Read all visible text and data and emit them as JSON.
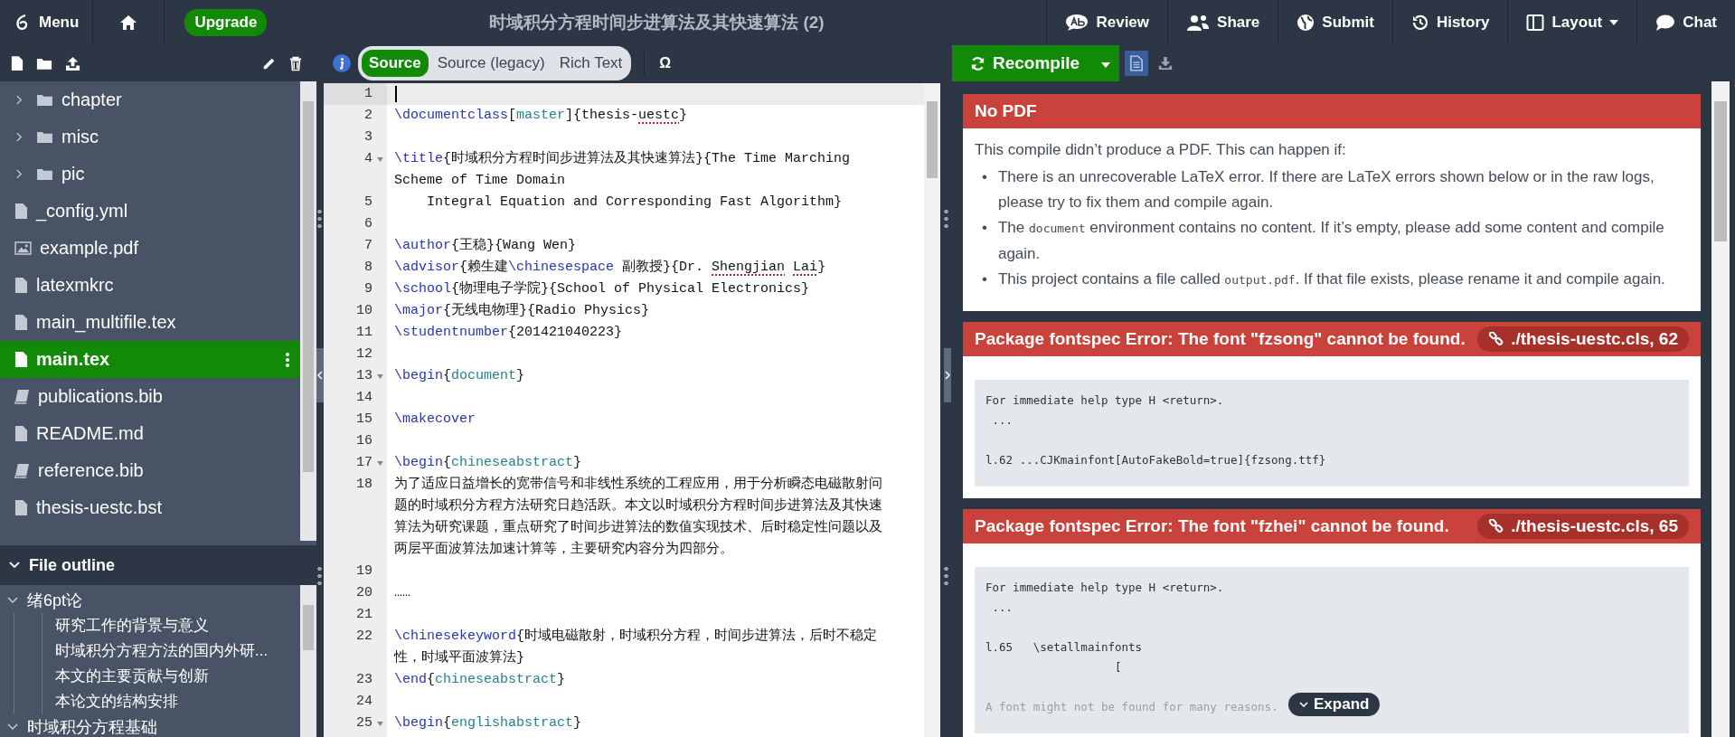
{
  "topbar": {
    "menu": "Menu",
    "upgrade": "Upgrade",
    "title": "时域积分方程时间步进算法及其快速算法 (2)",
    "actions": [
      {
        "kind": "review",
        "label": "Review"
      },
      {
        "kind": "share",
        "label": "Share"
      },
      {
        "kind": "submit",
        "label": "Submit"
      },
      {
        "kind": "history",
        "label": "History"
      },
      {
        "kind": "layout",
        "label": "Layout"
      },
      {
        "kind": "chat",
        "label": "Chat"
      }
    ]
  },
  "file_tree": [
    {
      "kind": "folder",
      "name": "chapter",
      "selected": false
    },
    {
      "kind": "folder",
      "name": "misc",
      "selected": false
    },
    {
      "kind": "folder",
      "name": "pic",
      "selected": false
    },
    {
      "kind": "file",
      "name": "_config.yml",
      "selected": false
    },
    {
      "kind": "image",
      "name": "example.pdf",
      "selected": false
    },
    {
      "kind": "file",
      "name": "latexmkrc",
      "selected": false
    },
    {
      "kind": "file",
      "name": "main_multifile.tex",
      "selected": false
    },
    {
      "kind": "file",
      "name": "main.tex",
      "selected": true
    },
    {
      "kind": "bib",
      "name": "publications.bib",
      "selected": false
    },
    {
      "kind": "file",
      "name": "README.md",
      "selected": false
    },
    {
      "kind": "bib",
      "name": "reference.bib",
      "selected": false
    },
    {
      "kind": "file",
      "name": "thesis-uestc.bst",
      "selected": false
    }
  ],
  "file_outline": {
    "title": "File outline",
    "expanded": true,
    "items": [
      {
        "label": "绪6pt论",
        "expanded": true,
        "children": [
          {
            "label": "研究工作的背景与意义"
          },
          {
            "label": "时域积分方程方法的国内外研..."
          },
          {
            "label": "本文的主要贡献与创新"
          },
          {
            "label": "本论文的结构安排"
          }
        ]
      },
      {
        "label": "时域积分方程基础",
        "expanded": true
      }
    ]
  },
  "editor_modes": [
    {
      "label": "Source",
      "selected": true
    },
    {
      "label": "Source (legacy)",
      "selected": false
    },
    {
      "label": "Rich Text",
      "selected": false
    }
  ],
  "symbol_button": "Ω",
  "editor_lines": [
    {
      "n": "1",
      "fold": false,
      "active": true
    },
    {
      "n": "2",
      "fold": false,
      "active": false,
      "rows": [
        [
          {
            "kind": "cmd",
            "text": "\\documentclass"
          },
          {
            "kind": "text",
            "text": "["
          },
          {
            "kind": "arg",
            "text": "master"
          },
          {
            "kind": "text",
            "text": "]{thesis-"
          },
          {
            "kind": "misspelled",
            "text": "uestc"
          },
          {
            "kind": "text",
            "text": "}"
          }
        ]
      ]
    },
    {
      "n": "3",
      "fold": false,
      "active": false
    },
    {
      "n": "4",
      "fold": true,
      "active": false,
      "rows": [
        [
          {
            "kind": "cmd",
            "text": "\\title"
          },
          {
            "kind": "text",
            "text": "{时域积分方程时间步进算法及其快速算法}{The Time Marching"
          }
        ],
        [
          {
            "kind": "text",
            "text": "Scheme of Time Domain"
          }
        ]
      ]
    },
    {
      "n": "5",
      "fold": false,
      "active": false,
      "rows": [
        [
          {
            "kind": "text",
            "text": "    Integral Equation and Corresponding Fast Algorithm}"
          }
        ]
      ]
    },
    {
      "n": "6",
      "fold": false,
      "active": false
    },
    {
      "n": "7",
      "fold": false,
      "active": false,
      "rows": [
        [
          {
            "kind": "cmd",
            "text": "\\author"
          },
          {
            "kind": "text",
            "text": "{王稳}{Wang Wen}"
          }
        ]
      ]
    },
    {
      "n": "8",
      "fold": false,
      "active": false,
      "rows": [
        [
          {
            "kind": "cmd",
            "text": "\\advisor"
          },
          {
            "kind": "text",
            "text": "{赖生建"
          },
          {
            "kind": "cmd",
            "text": "\\chinesespace"
          },
          {
            "kind": "text",
            "text": " 副教授}{Dr. "
          },
          {
            "kind": "misspelled",
            "text": "Shengjian"
          },
          {
            "kind": "text",
            "text": " "
          },
          {
            "kind": "misspelled",
            "text": "Lai"
          },
          {
            "kind": "text",
            "text": "}"
          }
        ]
      ]
    },
    {
      "n": "9",
      "fold": false,
      "active": false,
      "rows": [
        [
          {
            "kind": "cmd",
            "text": "\\school"
          },
          {
            "kind": "text",
            "text": "{物理电子学院}{School of Physical Electronics}"
          }
        ]
      ]
    },
    {
      "n": "10",
      "fold": false,
      "active": false,
      "rows": [
        [
          {
            "kind": "cmd",
            "text": "\\major"
          },
          {
            "kind": "text",
            "text": "{无线电物理}{Radio Physics}"
          }
        ]
      ]
    },
    {
      "n": "11",
      "fold": false,
      "active": false,
      "rows": [
        [
          {
            "kind": "cmd",
            "text": "\\studentnumber"
          },
          {
            "kind": "text",
            "text": "{201421040223}"
          }
        ]
      ]
    },
    {
      "n": "12",
      "fold": false,
      "active": false
    },
    {
      "n": "13",
      "fold": true,
      "active": false,
      "rows": [
        [
          {
            "kind": "cmd",
            "text": "\\begin"
          },
          {
            "kind": "text",
            "text": "{"
          },
          {
            "kind": "arg",
            "text": "document"
          },
          {
            "kind": "text",
            "text": "}"
          }
        ]
      ]
    },
    {
      "n": "14",
      "fold": false,
      "active": false
    },
    {
      "n": "15",
      "fold": false,
      "active": false,
      "rows": [
        [
          {
            "kind": "cmd",
            "text": "\\makecover"
          }
        ]
      ]
    },
    {
      "n": "16",
      "fold": false,
      "active": false
    },
    {
      "n": "17",
      "fold": true,
      "active": false,
      "rows": [
        [
          {
            "kind": "cmd",
            "text": "\\begin"
          },
          {
            "kind": "text",
            "text": "{"
          },
          {
            "kind": "arg",
            "text": "chineseabstract"
          },
          {
            "kind": "text",
            "text": "}"
          }
        ]
      ]
    },
    {
      "n": "18",
      "fold": false,
      "active": false,
      "rows": [
        [
          {
            "kind": "text",
            "text": "为了适应日益增长的宽带信号和非线性系统的工程应用，用于分析瞬态电磁散射问"
          }
        ],
        [
          {
            "kind": "text",
            "text": "题的时域积分方程方法研究日趋活跃。本文以时域积分方程时间步进算法及其快速"
          }
        ],
        [
          {
            "kind": "text",
            "text": "算法为研究课题，重点研究了时间步进算法的数值实现技术、后时稳定性问题以及"
          }
        ],
        [
          {
            "kind": "text",
            "text": "两层平面波算法加速计算等，主要研究内容分为四部分。"
          }
        ]
      ]
    },
    {
      "n": "19",
      "fold": false,
      "active": false
    },
    {
      "n": "20",
      "fold": false,
      "active": false,
      "rows": [
        [
          {
            "kind": "text",
            "text": "……"
          }
        ]
      ]
    },
    {
      "n": "21",
      "fold": false,
      "active": false
    },
    {
      "n": "22",
      "fold": false,
      "active": false,
      "rows": [
        [
          {
            "kind": "cmd",
            "text": "\\chinesekeyword"
          },
          {
            "kind": "text",
            "text": "{时域电磁散射，时域积分方程，时间步进算法，后时不稳定"
          }
        ],
        [
          {
            "kind": "text",
            "text": "性，时域平面波算法}"
          }
        ]
      ]
    },
    {
      "n": "23",
      "fold": false,
      "active": false,
      "rows": [
        [
          {
            "kind": "cmd",
            "text": "\\end"
          },
          {
            "kind": "text",
            "text": "{"
          },
          {
            "kind": "arg",
            "text": "chineseabstract"
          },
          {
            "kind": "text",
            "text": "}"
          }
        ]
      ]
    },
    {
      "n": "24",
      "fold": false,
      "active": false
    },
    {
      "n": "25",
      "fold": true,
      "active": false,
      "rows": [
        [
          {
            "kind": "cmd",
            "text": "\\begin"
          },
          {
            "kind": "text",
            "text": "{"
          },
          {
            "kind": "arg",
            "text": "englishabstract"
          },
          {
            "kind": "text",
            "text": "}"
          }
        ]
      ]
    }
  ],
  "recompile": {
    "label": "Recompile"
  },
  "pdf_view_modes": [
    {
      "kind": "document",
      "selected": true
    },
    {
      "kind": "download",
      "selected": false
    }
  ],
  "no_pdf": {
    "title": "No PDF",
    "intro": "This compile didn’t produce a PDF. This can happen if:",
    "bullets": [
      {
        "marker": "•",
        "parts": [
          {
            "kind": "text",
            "text": "There is an unrecoverable LaTeX error. If there are LaTeX errors shown below or in the raw logs, please try to fix them and compile again."
          }
        ]
      },
      {
        "marker": "•",
        "parts": [
          {
            "kind": "text",
            "text": "The "
          },
          {
            "kind": "code",
            "text": "document"
          },
          {
            "kind": "text",
            "text": " environment contains no content. If it’s empty, please add some content and compile again."
          }
        ]
      },
      {
        "marker": "•",
        "parts": [
          {
            "kind": "text",
            "text": "This project contains a file called "
          },
          {
            "kind": "code",
            "text": "output.pdf"
          },
          {
            "kind": "text",
            "text": ". If that file exists, please rename it and compile again."
          }
        ]
      }
    ]
  },
  "errors": [
    {
      "title": "Package fontspec Error: The font \"fzsong\" cannot be found.",
      "location": "./thesis-uestc.cls, 62",
      "log": "For immediate help type H <return>.\n ...\n\nl.62 ...CJKmainfont[AutoFakeBold=true]{fzsong.ttf}"
    },
    {
      "title": "Package fontspec Error: The font \"fzhei\" cannot be found.",
      "location": "./thesis-uestc.cls, 65",
      "log": "For immediate help type H <return>.\n ...\n\nl.65   \\setallmainfonts\n                   [",
      "hint": "A font might not be found for many reasons."
    }
  ],
  "expand_button": "Expand"
}
